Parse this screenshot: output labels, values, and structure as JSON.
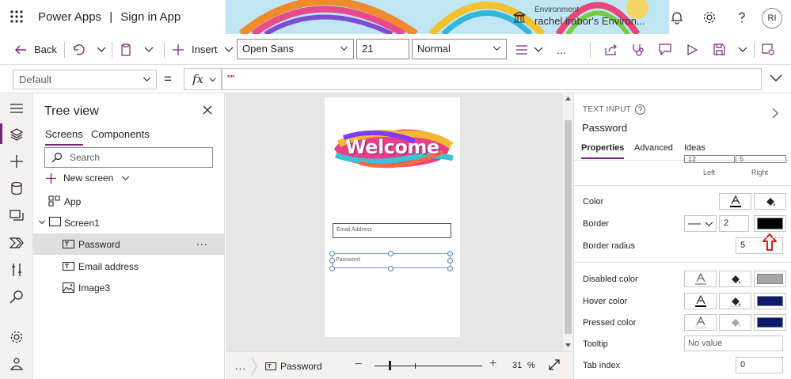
{
  "header": {
    "app_name": "Power Apps",
    "separator": "|",
    "app_title": "Sign in App",
    "environment_label": "Environment",
    "environment_value": "rachel irabor's Environ...",
    "avatar_initials": "RI",
    "icons": [
      "waffle-icon",
      "environment-icon",
      "bell-icon",
      "gear-icon",
      "help-icon"
    ]
  },
  "command_bar": {
    "back_label": "Back",
    "insert_label": "Insert",
    "font_family": "Open Sans",
    "font_size": "21",
    "font_weight": "Normal",
    "overflow": "..."
  },
  "formula_bar": {
    "property": "Default",
    "equals": "=",
    "fx_label": "fx",
    "formula": "\"\""
  },
  "tree_view": {
    "title": "Tree view",
    "tabs": [
      {
        "label": "Screens",
        "active": true
      },
      {
        "label": "Components",
        "active": false
      }
    ],
    "search_placeholder": "Search",
    "new_screen_label": "New screen",
    "nodes": [
      {
        "label": "App",
        "icon": "app-icon",
        "level": 0
      },
      {
        "label": "Screen1",
        "icon": "screen-icon",
        "level": 0,
        "expanded": true
      },
      {
        "label": "Password",
        "icon": "text-input-icon",
        "level": 1,
        "selected": true
      },
      {
        "label": "Email address",
        "icon": "text-input-icon",
        "level": 1
      },
      {
        "label": "Image3",
        "icon": "image-icon",
        "level": 1
      }
    ],
    "more_label": "..."
  },
  "canvas": {
    "welcome_text": "Welcome",
    "email_placeholder": "Email Address",
    "password_placeholder": "Password"
  },
  "status_bar": {
    "overflow": "...",
    "selected_control": "Password",
    "zoom_value": "31",
    "zoom_unit": "%",
    "zoom_fraction": 0.13
  },
  "properties_panel": {
    "control_type": "TEXT INPUT",
    "control_name": "Password",
    "tabs": [
      {
        "label": "Properties",
        "active": true
      },
      {
        "label": "Advanced",
        "active": false
      },
      {
        "label": "Ideas",
        "active": false
      }
    ],
    "padding": {
      "left_value": "12",
      "right_value": "5",
      "left_label": "Left",
      "right_label": "Right"
    },
    "color_label": "Color",
    "border_label": "Border",
    "border_thickness": "2",
    "border_color": "#000000",
    "border_radius_label": "Border radius",
    "border_radius": "5",
    "disabled_color_label": "Disabled color",
    "disabled_color": "#a6a6a6",
    "hover_color_label": "Hover color",
    "hover_color": "#0c1a6b",
    "pressed_color_label": "Pressed color",
    "pressed_color": "#0c1a6b",
    "tooltip_label": "Tooltip",
    "tooltip_value": "No value",
    "tab_index_label": "Tab index",
    "tab_index": "0"
  },
  "colors": {
    "accent": "#742774",
    "annotation_arrow": "#e00000",
    "selection_handle": "#4a7fc1"
  }
}
